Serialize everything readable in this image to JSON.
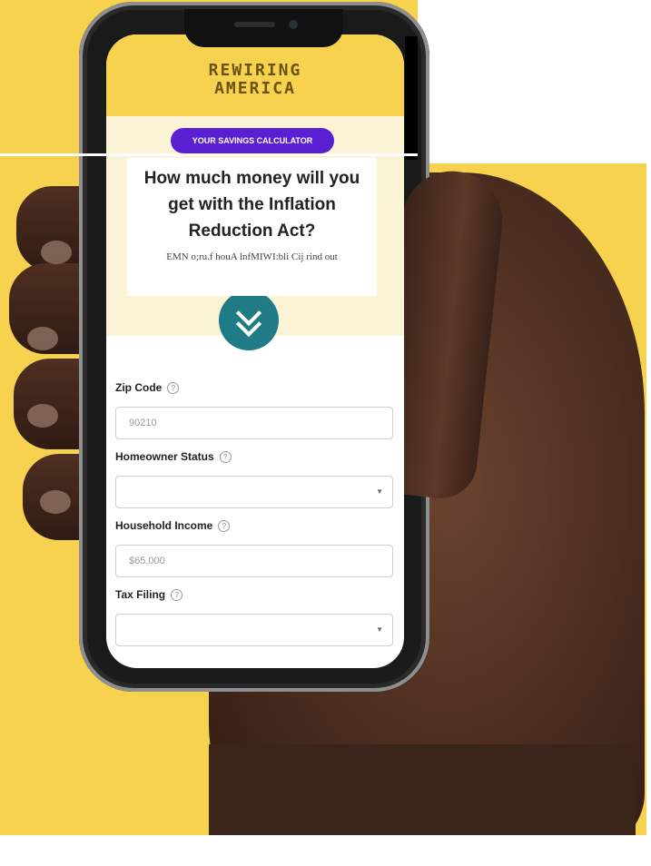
{
  "colors": {
    "background_yellow": "#f6d24f",
    "cta_purple": "#5a1fd0",
    "chevron_teal": "#1f7b86",
    "hero_cream": "#fbf3d5"
  },
  "app": {
    "logo_line1": "REWIRING",
    "logo_line2": "AMERICA",
    "cta_label": "YOUR SAVINGS CALCULATOR",
    "chevron_icon": "chevron-double-down"
  },
  "overlay": {
    "headline": "How much money will you get with the Inflation Reduction Act?",
    "subtext": "EMN o;ru.f houA lnfMIWI:bli Cij rind out"
  },
  "form": {
    "zip_label": "Zip Code",
    "zip_placeholder": "90210",
    "homeowner_label": "Homeowner Status",
    "homeowner_value": "",
    "income_label": "Household Income",
    "income_placeholder": "$65,000",
    "tax_label": "Tax Filing",
    "tax_value": "",
    "help_icon_char": "?",
    "dropdown_caret": "▼"
  }
}
